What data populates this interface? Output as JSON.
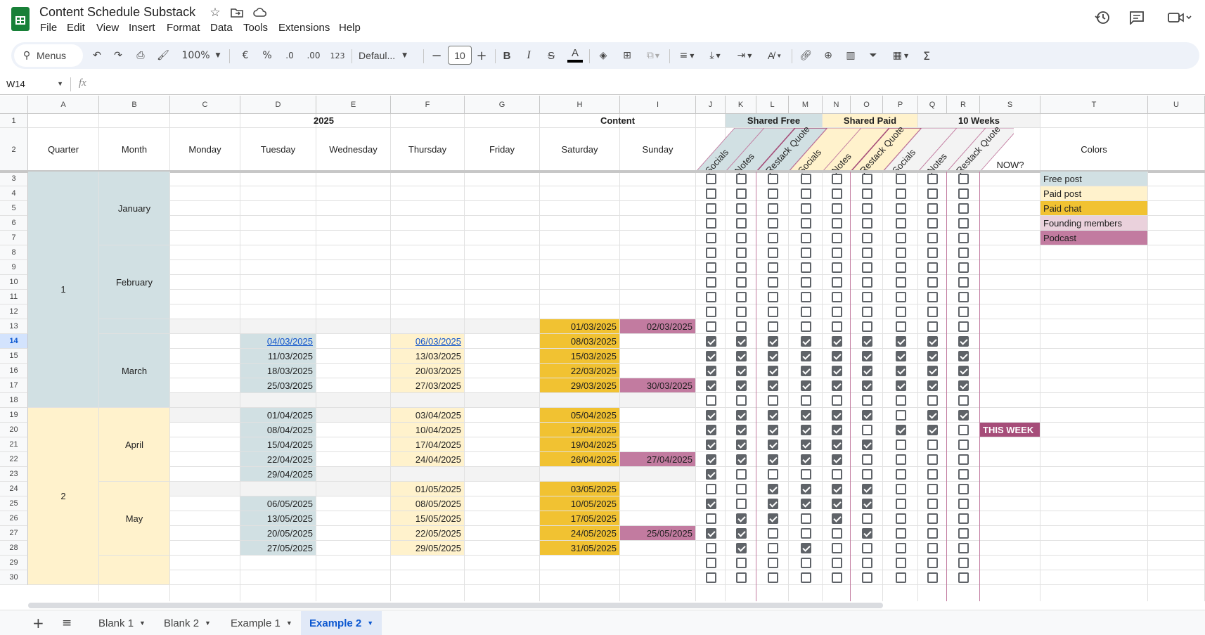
{
  "app": {
    "title": "Content Schedule Substack",
    "menu": [
      "File",
      "Edit",
      "View",
      "Insert",
      "Format",
      "Data",
      "Tools",
      "Extensions",
      "Help"
    ]
  },
  "toolbar": {
    "search": "Menus",
    "zoom": "100%",
    "currency": "€",
    "percent": "%",
    "dec_less": ".0",
    "dec_more": ".00",
    "format123": "123",
    "font": "Defaul...",
    "font_size": "10"
  },
  "formula": {
    "cell_ref": "W14",
    "fx": "fx"
  },
  "columns": [
    "A",
    "B",
    "C",
    "D",
    "E",
    "F",
    "G",
    "H",
    "I",
    "J",
    "K",
    "L",
    "M",
    "N",
    "O",
    "P",
    "Q",
    "R",
    "S",
    "T",
    "U"
  ],
  "header": {
    "year": "2025",
    "content": "Content",
    "shared_free": "Shared Free",
    "shared_paid": "Shared Paid",
    "ten_weeks": "10 Weeks",
    "quarter": "Quarter",
    "month": "Month",
    "days": [
      "Monday",
      "Tuesday",
      "Wednesday",
      "Thursday",
      "Friday",
      "Saturday",
      "Sunday"
    ],
    "rot": [
      "Socials",
      "Notes",
      "Restack Quote",
      "Socials",
      "Notes",
      "Restack Quote",
      "Socials",
      "Notes",
      "Restack Quote"
    ],
    "now": "NOW?",
    "colors": "Colors"
  },
  "legend": [
    {
      "label": "Free post",
      "color": "#d1e0e3"
    },
    {
      "label": "Paid post",
      "color": "#fff2cc"
    },
    {
      "label": "Paid chat",
      "color": "#f1c232"
    },
    {
      "label": "Founding members",
      "color": "#ead1dc"
    },
    {
      "label": "Podcast",
      "color": "#c27ba0"
    }
  ],
  "quarters": [
    {
      "label": "1",
      "color": "#d1e0e3"
    },
    {
      "label": "2",
      "color": "#fff2cc"
    }
  ],
  "months": [
    "January",
    "February",
    "March",
    "April",
    "May"
  ],
  "rows": [
    {
      "n": 13,
      "sat": "01/03/2025",
      "sun": "02/03/2025",
      "gray": true,
      "checks": "000000000"
    },
    {
      "n": 14,
      "tue": "04/03/2025",
      "thu": "06/03/2025",
      "sat": "08/03/2025",
      "link": true,
      "checks": "111111111"
    },
    {
      "n": 15,
      "tue": "11/03/2025",
      "thu": "13/03/2025",
      "sat": "15/03/2025",
      "checks": "111111111"
    },
    {
      "n": 16,
      "tue": "18/03/2025",
      "thu": "20/03/2025",
      "sat": "22/03/2025",
      "checks": "111111111"
    },
    {
      "n": 17,
      "tue": "25/03/2025",
      "thu": "27/03/2025",
      "sat": "29/03/2025",
      "sun": "30/03/2025",
      "checks": "111111111"
    },
    {
      "n": 18,
      "gray2": true,
      "checks": "000000000"
    },
    {
      "n": 19,
      "tue": "01/04/2025",
      "thu": "03/04/2025",
      "sat": "05/04/2025",
      "graymon": true,
      "checks": "111111011"
    },
    {
      "n": 20,
      "tue": "08/04/2025",
      "thu": "10/04/2025",
      "sat": "12/04/2025",
      "now": "THIS WEEK",
      "checks": "111110110"
    },
    {
      "n": 21,
      "tue": "15/04/2025",
      "thu": "17/04/2025",
      "sat": "19/04/2025",
      "checks": "111111000"
    },
    {
      "n": 22,
      "tue": "22/04/2025",
      "thu": "24/04/2025",
      "sat": "26/04/2025",
      "sun": "27/04/2025",
      "checks": "111110000"
    },
    {
      "n": 23,
      "tue": "29/04/2025",
      "graytail": true,
      "checks": "100000000"
    },
    {
      "n": 24,
      "thu": "01/05/2025",
      "sat": "03/05/2025",
      "grayhead": true,
      "checks": "001111000"
    },
    {
      "n": 25,
      "tue": "06/05/2025",
      "thu": "08/05/2025",
      "sat": "10/05/2025",
      "checks": "101111000"
    },
    {
      "n": 26,
      "tue": "13/05/2025",
      "thu": "15/05/2025",
      "sat": "17/05/2025",
      "checks": "011010000"
    },
    {
      "n": 27,
      "tue": "20/05/2025",
      "thu": "22/05/2025",
      "sat": "24/05/2025",
      "sun": "25/05/2025",
      "checks": "110001000"
    },
    {
      "n": 28,
      "tue": "27/05/2025",
      "thu": "29/05/2025",
      "sat": "31/05/2025",
      "checks": "010100000"
    },
    {
      "n": 29,
      "checks": "000000000"
    },
    {
      "n": 30,
      "checks": "000000000"
    }
  ],
  "tabs": [
    "Blank 1",
    "Blank 2",
    "Example 1",
    "Example 2"
  ],
  "active_tab": "Example 2",
  "colors": {
    "free": "#d1e0e3",
    "paid": "#fff2cc",
    "chat": "#f1c232",
    "podcast": "#c27ba0",
    "founding": "#ead1dc",
    "thisweek": "#a64d79",
    "gray": "#f3f3f3",
    "link": "#1155cc",
    "accent": "#0b57d0"
  }
}
